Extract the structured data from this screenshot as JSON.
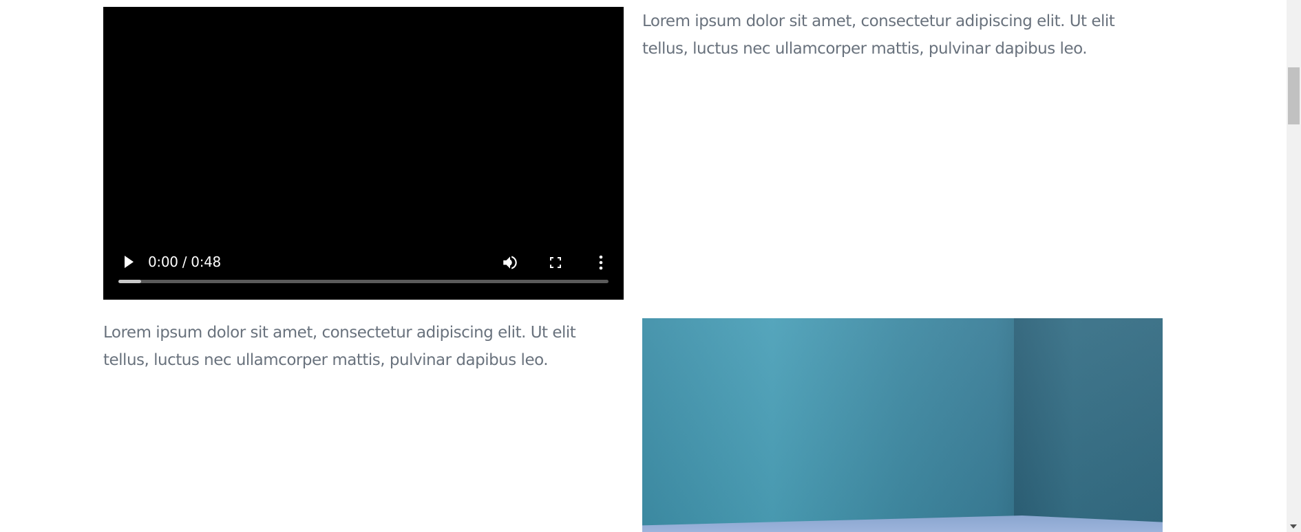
{
  "video": {
    "time_display": "0:00 / 0:48",
    "progress_percent": 0,
    "buffered_percent": 4.7,
    "icons": [
      "play-icon",
      "volume-icon",
      "fullscreen-icon",
      "more-options-icon"
    ]
  },
  "sections": [
    {
      "text": "Lorem ipsum dolor sit amet, consectetur adipiscing elit. Ut elit tellus, luctus nec ullamcorper mattis, pulvinar dapibus leo."
    },
    {
      "text": "Lorem ipsum dolor sit amet, consectetur adipiscing elit. Ut elit tellus, luctus nec ullamcorper mattis, pulvinar dapibus leo."
    }
  ],
  "colors": {
    "body_text": "#69727d",
    "video_bg": "#000000",
    "image_wall": "#4ba0b8",
    "image_floor": "#9db4dc"
  }
}
